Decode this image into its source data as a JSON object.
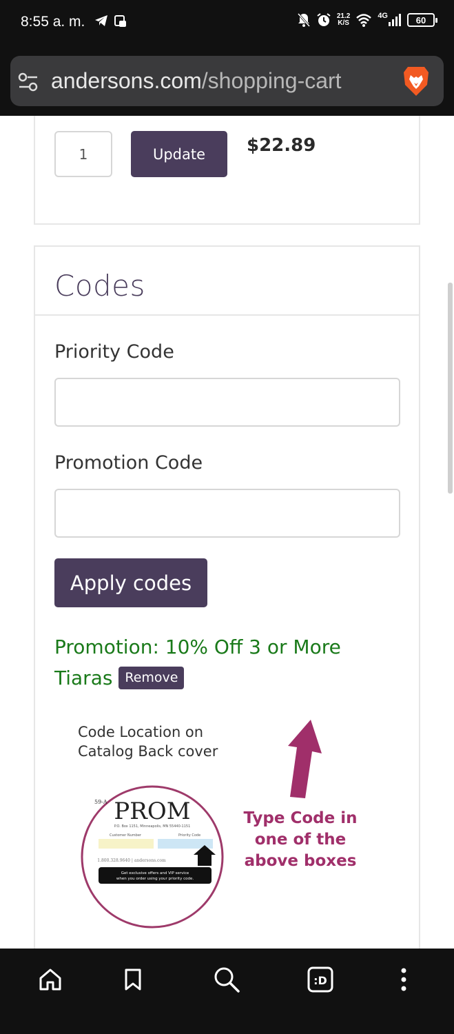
{
  "status_bar": {
    "time": "8:55 a. m.",
    "net_speed_value": "21.2",
    "net_speed_unit": "K/S",
    "network_type": "4G",
    "battery": "60"
  },
  "browser": {
    "url_domain": "andersons.com",
    "url_path": "/shopping-cart"
  },
  "cart_item": {
    "quantity": "1",
    "update_label": "Update",
    "price": "$22.89"
  },
  "codes": {
    "title": "Codes",
    "priority_label": "Priority Code",
    "priority_value": "",
    "promotion_label": "Promotion Code",
    "promotion_value": "",
    "apply_label": "Apply codes",
    "applied_promotion": "Promotion: 10% Off 3 or More Tiaras",
    "remove_label": "Remove"
  },
  "code_graphic": {
    "caption_line1": "Code Location on",
    "caption_line2": "Catalog Back cover",
    "catalog_title": "PROM",
    "catalog_address": "P.O. Box 1151, Minneapolis, MN 55440-1151",
    "customer_number_label": "Customer Number",
    "priority_code_label": "Priority Code",
    "contact_line": "1.800.328.9640 | andersons.com",
    "offer_line1": "Get exclusive offers and VIP service",
    "offer_line2": "when you order using your priority code.",
    "instruction_line1": "Type Code in",
    "instruction_line2": "one of the",
    "instruction_line3": "above boxes"
  },
  "colors": {
    "brand_purple": "#4a3d5c",
    "promo_green": "#1a7a1a",
    "arrow_magenta": "#a02f6a"
  },
  "icons": {
    "nav": [
      "home-icon",
      "bookmark-icon",
      "search-icon",
      "tabs-icon",
      "more-icon"
    ]
  }
}
